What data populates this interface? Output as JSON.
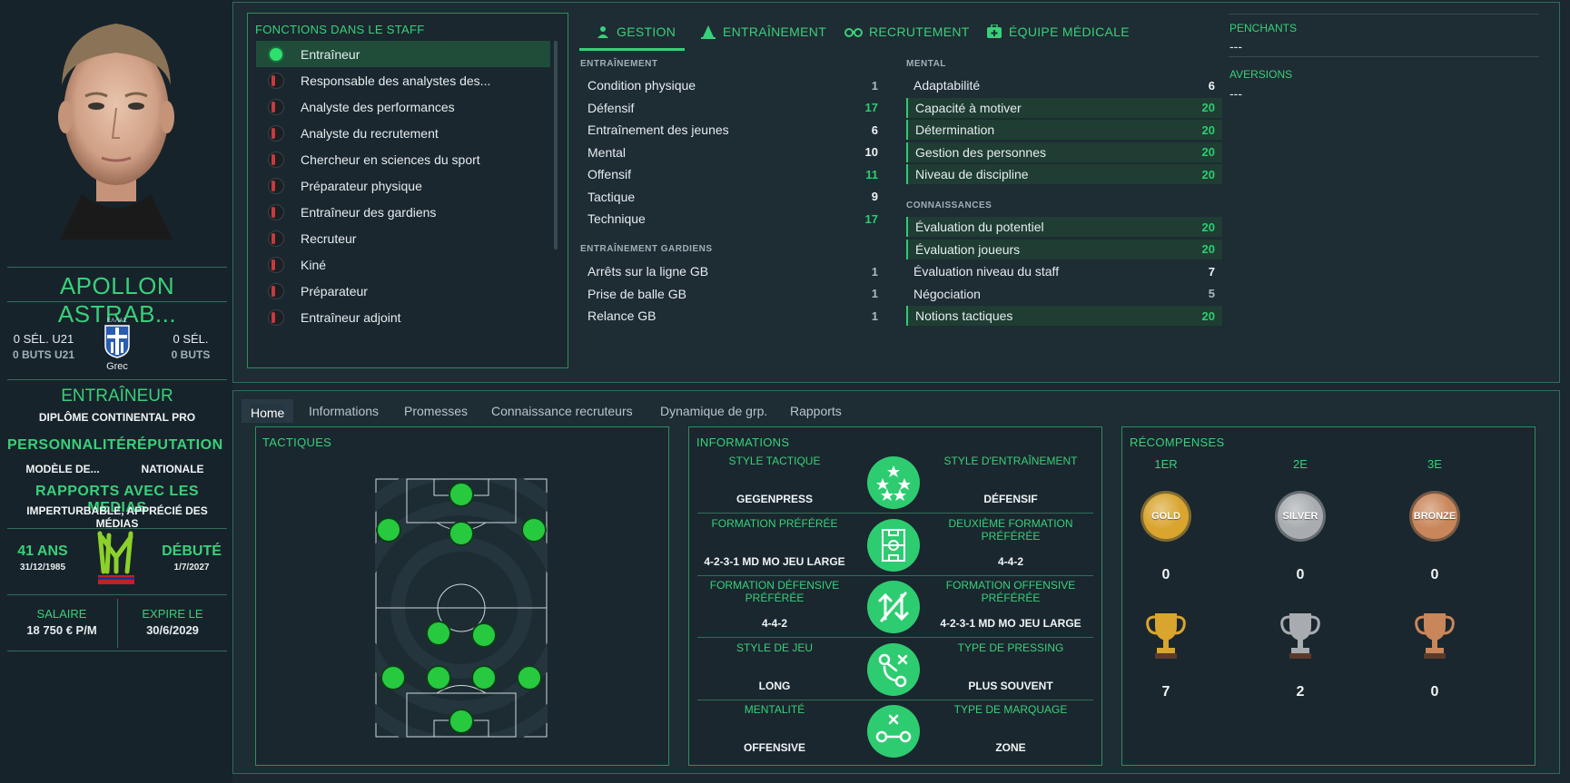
{
  "profile": {
    "name": "APOLLON ASTRAB...",
    "sel_u21": "0 SÉL. U21",
    "buts_u21": "0 BUTS U21",
    "sel": "0 SÉL.",
    "buts": "0 BUTS",
    "nationality": "Grec",
    "flag_text": "ΕΛΛΑΣ",
    "role": "ENTRAÎNEUR",
    "diploma": "DIPLÔME CONTINENTAL PRO",
    "personality_label": "PERSONNALITÉ",
    "personality_value": "MODÈLE DE...",
    "reputation_label": "RÉPUTATION",
    "reputation_value": "NATIONALE",
    "media_label": "RAPPORTS AVEC LES MEDIAS",
    "media_value": "IMPERTURBABLE, APPRÉCIÉ DES MÉDIAS",
    "age": "41 ANS",
    "birthdate": "31/12/1985",
    "debut_label": "DÉBUTÉ",
    "debut_date": "1/7/2027",
    "salary_label": "SALAIRE",
    "salary_value": "18 750 € P/M",
    "expires_label": "EXPIRE LE",
    "expires_value": "30/6/2029"
  },
  "staff_functions": {
    "title": "FONCTIONS DANS LE STAFF",
    "items": [
      {
        "label": "Entraîneur",
        "active": true
      },
      {
        "label": "Responsable des analystes des...",
        "active": false
      },
      {
        "label": "Analyste des performances",
        "active": false
      },
      {
        "label": "Analyste du recrutement",
        "active": false
      },
      {
        "label": "Chercheur en sciences du sport",
        "active": false
      },
      {
        "label": "Préparateur physique",
        "active": false
      },
      {
        "label": "Entraîneur des gardiens",
        "active": false
      },
      {
        "label": "Recruteur",
        "active": false
      },
      {
        "label": "Kiné",
        "active": false
      },
      {
        "label": "Préparateur",
        "active": false
      },
      {
        "label": "Entraîneur adjoint",
        "active": false
      }
    ]
  },
  "attr_tabs": [
    {
      "label": "GESTION",
      "icon": "person-icon",
      "active": true
    },
    {
      "label": "ENTRAÎNEMENT",
      "icon": "cone-icon",
      "active": false
    },
    {
      "label": "RECRUTEMENT",
      "icon": "binoculars-icon",
      "active": false
    },
    {
      "label": "ÉQUIPE MÉDICALE",
      "icon": "medical-kit-icon",
      "active": false
    }
  ],
  "attributes": {
    "training_head": "ENTRAÎNEMENT",
    "training": [
      {
        "label": "Condition physique",
        "value": "1"
      },
      {
        "label": "Défensif",
        "value": "17"
      },
      {
        "label": "Entraînement des jeunes",
        "value": "6"
      },
      {
        "label": "Mental",
        "value": "10"
      },
      {
        "label": "Offensif",
        "value": "11"
      },
      {
        "label": "Tactique",
        "value": "9"
      },
      {
        "label": "Technique",
        "value": "17"
      }
    ],
    "gk_head": "ENTRAÎNEMENT GARDIENS",
    "gk": [
      {
        "label": "Arrêts sur la ligne GB",
        "value": "1"
      },
      {
        "label": "Prise de balle GB",
        "value": "1"
      },
      {
        "label": "Relance GB",
        "value": "1"
      }
    ],
    "mental_head": "MENTAL",
    "mental": [
      {
        "label": "Adaptabilité",
        "value": "6"
      },
      {
        "label": "Capacité à motiver",
        "value": "20"
      },
      {
        "label": "Détermination",
        "value": "20"
      },
      {
        "label": "Gestion des personnes",
        "value": "20"
      },
      {
        "label": "Niveau de discipline",
        "value": "20"
      }
    ],
    "knowledge_head": "CONNAISSANCES",
    "knowledge": [
      {
        "label": "Évaluation du potentiel",
        "value": "20"
      },
      {
        "label": "Évaluation joueurs",
        "value": "20"
      },
      {
        "label": "Évaluation niveau du staff",
        "value": "7"
      },
      {
        "label": "Négociation",
        "value": "5"
      },
      {
        "label": "Notions tactiques",
        "value": "20"
      }
    ]
  },
  "prefs": {
    "likes_label": "PENCHANTS",
    "likes_value": "---",
    "dislikes_label": "AVERSIONS",
    "dislikes_value": "---"
  },
  "bottom_tabs": [
    "Home",
    "Informations",
    "Promesses",
    "Connaissance recruteurs",
    "Dynamique de grp.",
    "Rapports"
  ],
  "tactics": {
    "title": "TACTIQUES"
  },
  "informations": {
    "title": "INFORMATIONS",
    "rows": [
      {
        "left_label": "STYLE TACTIQUE",
        "left_value": "GEGENPRESS",
        "icon": "stars-icon",
        "right_label": "STYLE D'ENTRAÎNEMENT",
        "right_value": "DÉFENSIF"
      },
      {
        "left_label": "FORMATION PRÉFÉRÉE",
        "left_value": "4-2-3-1 MD MO JEU LARGE",
        "icon": "pitch-icon",
        "right_label": "DEUXIÈME FORMATION PRÉFÉRÉE",
        "right_value": "4-4-2"
      },
      {
        "left_label": "FORMATION DÉFENSIVE PRÉFÉRÉE",
        "left_value": "4-4-2",
        "icon": "up-down-arrows-icon",
        "right_label": "FORMATION OFFENSIVE PRÉFÉRÉE",
        "right_value": "4-2-3-1 MD MO JEU LARGE"
      },
      {
        "left_label": "STYLE DE JEU",
        "left_value": "LONG",
        "icon": "tactic-play-icon",
        "right_label": "TYPE DE PRESSING",
        "right_value": "PLUS SOUVENT"
      },
      {
        "left_label": "MENTALITÉ",
        "left_value": "OFFENSIVE",
        "icon": "marking-icon",
        "right_label": "TYPE DE MARQUAGE",
        "right_value": "ZONE"
      }
    ]
  },
  "rewards": {
    "title": "RÉCOMPENSES",
    "ranks": [
      "1ER",
      "2E",
      "3E"
    ],
    "medal_labels": [
      "GOLD",
      "SILVER",
      "BRONZE"
    ],
    "medal_counts": [
      "0",
      "0",
      "0"
    ],
    "trophy_counts": [
      "7",
      "2",
      "0"
    ]
  },
  "colors": {
    "accent": "#39d07a",
    "panel_bg": "#1e2c33",
    "highlight_row": "#1f3d33",
    "gold": "#d9a52f",
    "silver": "#a8acb0",
    "bronze": "#c9865a"
  }
}
